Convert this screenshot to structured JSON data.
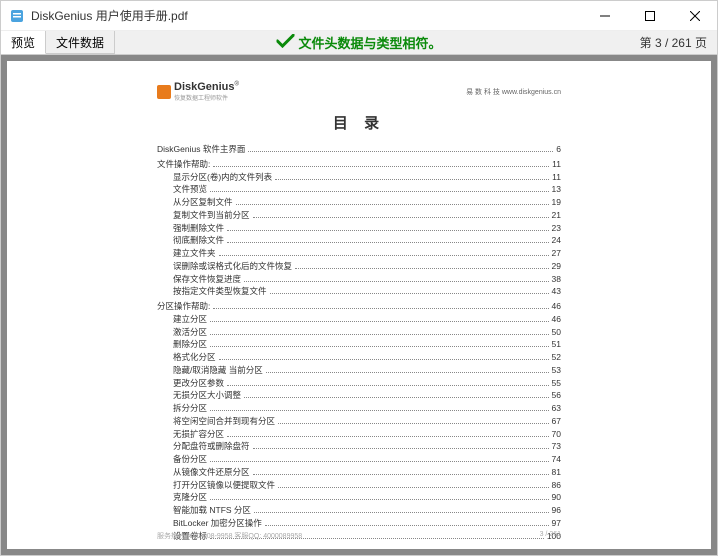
{
  "window": {
    "title": "DiskGenius 用户使用手册.pdf"
  },
  "tabs": {
    "preview": "预览",
    "filedata": "文件数据"
  },
  "status": {
    "message": "文件头数据与类型相符。"
  },
  "pager": {
    "text": "第 3 / 261 页"
  },
  "doc": {
    "logo_main": "DiskGenius",
    "logo_sub": "恢复数据工程师软件",
    "header_right": "易 数 科 技  www.diskgenius.cn",
    "toc_title": "目 录",
    "footer_left": "服务热线: 400-008-9958      客服QQ: 4000089958",
    "footer_right": "3 / 261"
  },
  "toc": [
    {
      "level": 1,
      "label": "DiskGenius 软件主界面",
      "page": "6"
    },
    {
      "level": 1,
      "label": "文件操作帮助:",
      "page": "11"
    },
    {
      "level": 2,
      "label": "显示分区(卷)内的文件列表",
      "page": "11"
    },
    {
      "level": 2,
      "label": "文件预览",
      "page": "13"
    },
    {
      "level": 2,
      "label": "从分区复制文件",
      "page": "19"
    },
    {
      "level": 2,
      "label": "复制文件到当前分区",
      "page": "21"
    },
    {
      "level": 2,
      "label": "强制删除文件",
      "page": "23"
    },
    {
      "level": 2,
      "label": "彻底删除文件",
      "page": "24"
    },
    {
      "level": 2,
      "label": "建立文件夹",
      "page": "27"
    },
    {
      "level": 2,
      "label": "误删除或误格式化后的文件恢复",
      "page": "29"
    },
    {
      "level": 2,
      "label": "保存文件恢复进度",
      "page": "38"
    },
    {
      "level": 2,
      "label": "按指定文件类型恢复文件",
      "page": "43"
    },
    {
      "level": 1,
      "label": "分区操作帮助:",
      "page": "46"
    },
    {
      "level": 2,
      "label": "建立分区",
      "page": "46"
    },
    {
      "level": 2,
      "label": "激活分区",
      "page": "50"
    },
    {
      "level": 2,
      "label": "删除分区",
      "page": "51"
    },
    {
      "level": 2,
      "label": "格式化分区",
      "page": "52"
    },
    {
      "level": 2,
      "label": "隐藏/取消隐藏 当前分区",
      "page": "53"
    },
    {
      "level": 2,
      "label": "更改分区参数",
      "page": "55"
    },
    {
      "level": 2,
      "label": "无损分区大小调整",
      "page": "56"
    },
    {
      "level": 2,
      "label": "拆分分区",
      "page": "63"
    },
    {
      "level": 2,
      "label": "将空闲空间合并到现有分区",
      "page": "67"
    },
    {
      "level": 2,
      "label": "无损扩容分区",
      "page": "70"
    },
    {
      "level": 2,
      "label": "分配盘符或删除盘符",
      "page": "73"
    },
    {
      "level": 2,
      "label": "备份分区",
      "page": "74"
    },
    {
      "level": 2,
      "label": "从镜像文件还原分区",
      "page": "81"
    },
    {
      "level": 2,
      "label": "打开分区镜像以便提取文件",
      "page": "86"
    },
    {
      "level": 2,
      "label": "克隆分区",
      "page": "90"
    },
    {
      "level": 2,
      "label": "智能加载 NTFS 分区",
      "page": "96"
    },
    {
      "level": 2,
      "label": "BitLocker 加密分区操作",
      "page": "97"
    },
    {
      "level": 2,
      "label": "设置卷标",
      "page": "100"
    }
  ]
}
